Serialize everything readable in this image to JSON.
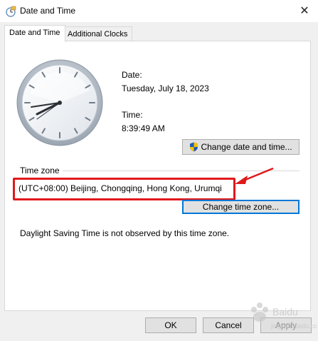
{
  "window": {
    "title": "Date and Time",
    "close_glyph": "✕"
  },
  "tabs": [
    {
      "label": "Date and Time",
      "active": true
    },
    {
      "label": "Additional Clocks",
      "active": false
    }
  ],
  "date": {
    "label": "Date:",
    "value": "Tuesday, July 18, 2023"
  },
  "time": {
    "label": "Time:",
    "value": "8:39:49 AM"
  },
  "buttons": {
    "change_date_time": "Change date and time...",
    "change_time_zone": "Change time zone...",
    "ok": "OK",
    "cancel": "Cancel",
    "apply": "Apply"
  },
  "timezone": {
    "section_label": "Time zone",
    "value": "(UTC+08:00) Beijing, Chongqing, Hong Kong, Urumqi"
  },
  "dst_note": "Daylight Saving Time is not observed by this time zone.",
  "watermark": {
    "text": "Baidu",
    "sub": "jingyan.baidu.com"
  },
  "colors": {
    "highlight_box": "#e0191b",
    "focus_border": "#0078d7"
  }
}
